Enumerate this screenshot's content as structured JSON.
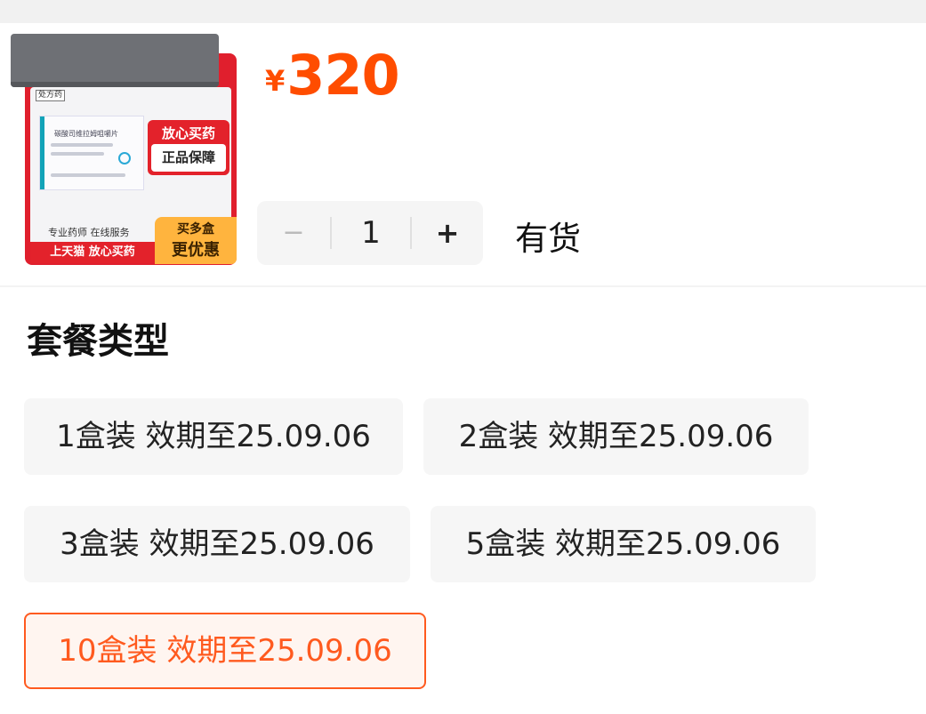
{
  "product": {
    "rx_tag": "处方药",
    "drug_name": "碳酸司维拉姆咀嚼片",
    "badge_top": "放心买药",
    "badge_bottom": "正品保障",
    "pharmacist_line": "专业药师 在线服务",
    "red_band": "上天猫 放心买药",
    "promo_line1": "买多盒",
    "promo_line2": "更优惠"
  },
  "price": {
    "symbol": "¥",
    "value": "320"
  },
  "stepper": {
    "minus": "−",
    "quantity": "1",
    "plus": "+"
  },
  "stock_status": "有货",
  "package_section": {
    "title": "套餐类型",
    "options": [
      {
        "label": "1盒装 效期至25.09.06",
        "selected": false
      },
      {
        "label": "2盒装 效期至25.09.06",
        "selected": false
      },
      {
        "label": "3盒装 效期至25.09.06",
        "selected": false
      },
      {
        "label": "5盒装 效期至25.09.06",
        "selected": false
      },
      {
        "label": "10盒装 效期至25.09.06",
        "selected": true
      }
    ]
  },
  "colors": {
    "accent": "#ff4d00",
    "selected_border": "#ff5a1f",
    "option_bg": "#f6f6f6",
    "brand_red": "#e3222b",
    "promo_yellow": "#ffb43e"
  }
}
